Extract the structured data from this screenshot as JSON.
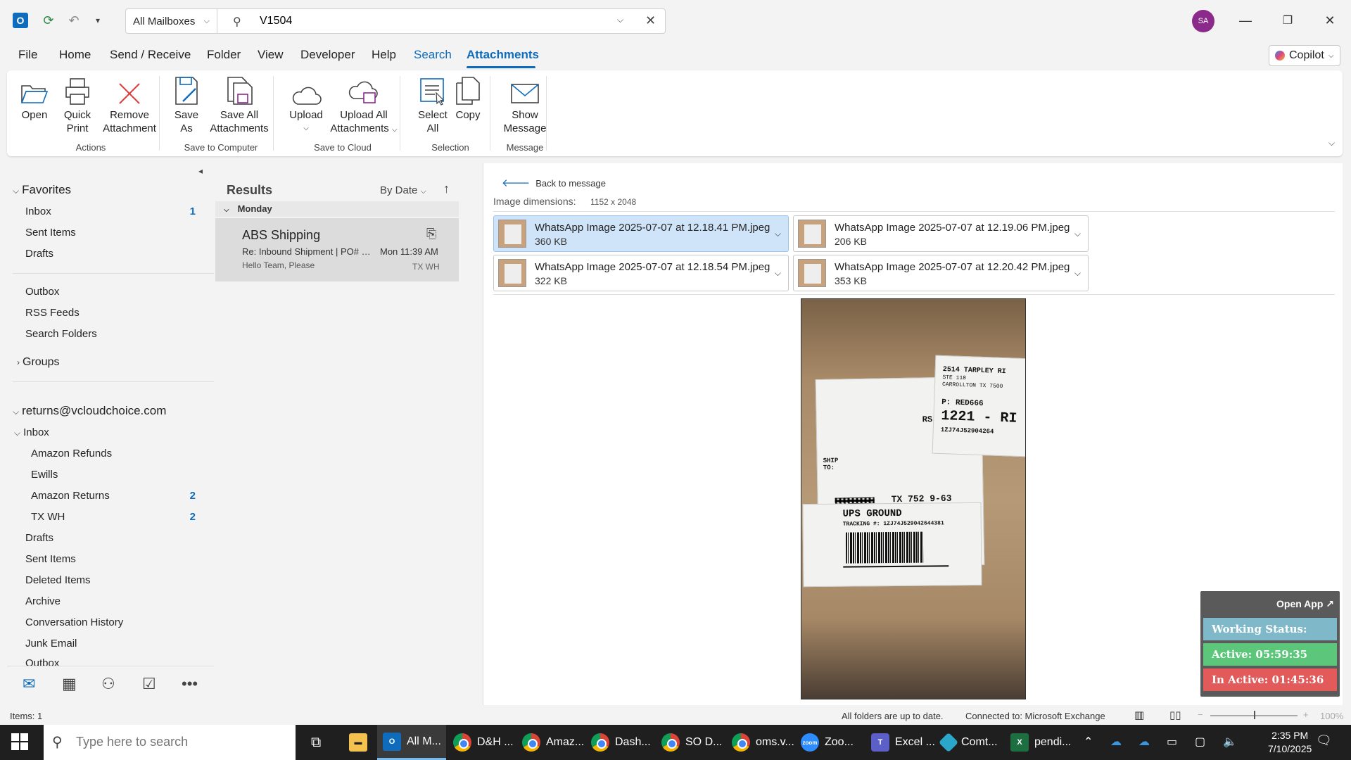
{
  "titlebar": {
    "scope": "All Mailboxes",
    "search_value": "V1504",
    "avatar_initials": "SA"
  },
  "menu": {
    "tabs": [
      "File",
      "Home",
      "Send / Receive",
      "Folder",
      "View",
      "Developer",
      "Help",
      "Search",
      "Attachments"
    ],
    "copilot": "Copilot"
  },
  "ribbon": {
    "buttons": {
      "open": "Open",
      "quick_print_1": "Quick",
      "quick_print_2": "Print",
      "remove_1": "Remove",
      "remove_2": "Attachment",
      "save_as_1": "Save",
      "save_as_2": "As",
      "save_all_1": "Save All",
      "save_all_2": "Attachments",
      "upload": "Upload",
      "upload_all_1": "Upload All",
      "upload_all_2": "Attachments",
      "select_all_1": "Select",
      "select_all_2": "All",
      "copy": "Copy",
      "show_msg_1": "Show",
      "show_msg_2": "Message"
    },
    "groups": {
      "actions": "Actions",
      "save_computer": "Save to Computer",
      "save_cloud": "Save to Cloud",
      "selection": "Selection",
      "message": "Message"
    }
  },
  "folders": {
    "favorites": "Favorites",
    "fav_inbox": "Inbox",
    "fav_inbox_count": "1",
    "fav_sent": "Sent Items",
    "fav_drafts": "Drafts",
    "outbox": "Outbox",
    "rss": "RSS Feeds",
    "search_folders": "Search Folders",
    "groups": "Groups",
    "account": "returns@vcloudchoice.com",
    "inbox": "Inbox",
    "amazon_refunds": "Amazon Refunds",
    "ewills": "Ewills",
    "amazon_returns": "Amazon Returns",
    "amazon_returns_count": "2",
    "tx_wh": "TX WH",
    "tx_wh_count": "2",
    "drafts": "Drafts",
    "sent": "Sent Items",
    "deleted": "Deleted Items",
    "archive": "Archive",
    "conv_history": "Conversation History",
    "junk": "Junk Email",
    "outbox2": "Outbox"
  },
  "results": {
    "title": "Results",
    "sort_by": "By Date",
    "group": "Monday",
    "item": {
      "sender": "ABS Shipping",
      "subject": "Re: Inbound Shipment | PO# U...",
      "time": "Mon 11:39 AM",
      "preview": "Hello Team,  Please",
      "folder": "TX WH"
    }
  },
  "reading": {
    "back": "Back to message",
    "dims_label": "Image dimensions:",
    "dims_value": "1152 x 2048",
    "attachments": [
      {
        "name": "WhatsApp Image 2025-07-07 at 12.18.41 PM.jpeg",
        "size": "360 KB"
      },
      {
        "name": "WhatsApp Image 2025-07-07 at 12.19.06 PM.jpeg",
        "size": "206 KB"
      },
      {
        "name": "WhatsApp Image 2025-07-07 at 12.18.54 PM.jpeg",
        "size": "322 KB"
      },
      {
        "name": "WhatsApp Image 2025-07-07 at 12.20.42 PM.jpeg",
        "size": "353 KB"
      }
    ]
  },
  "preview_label": {
    "side_addr1": "2514 TARPLEY RI",
    "side_addr2": "STE 118",
    "side_addr3": "CARROLLTON TX 7500",
    "side_ref": "P: RED666",
    "side_big": "1221 - RI",
    "side_track": "1ZJ74J52904264",
    "ship_to": "SHIP",
    "ship_to2": "TO:",
    "rs": "RS",
    "tx": "TX 752 9-63",
    "ground": "UPS GROUND",
    "tracking": "TRACKING #: 1ZJ74J529042644381"
  },
  "widget": {
    "open_app": "Open App ↗",
    "working": "Working Status: Active",
    "active": "Active: 05:59:35",
    "inactive": "In Active: 01:45:36"
  },
  "statusbar": {
    "items": "Items: 1",
    "sync": "All folders are up to date.",
    "connected": "Connected to: Microsoft Exchange",
    "zoom": "100%"
  },
  "taskbar": {
    "search_placeholder": "Type here to search",
    "apps": [
      "All M...",
      "D&H ...",
      "Amaz...",
      "Dash...",
      "SO D...",
      "oms.v...",
      "Zoo...",
      "Excel ...",
      "Comt...",
      "pendi..."
    ],
    "time": "2:35 PM",
    "date": "7/10/2025"
  },
  "colors": {
    "accent": "#0f6cbd",
    "selected_attachment": "#cfe4f8",
    "status_working": "#7fb8c8",
    "status_active": "#5cc77a",
    "status_inactive": "#e35a5a"
  }
}
